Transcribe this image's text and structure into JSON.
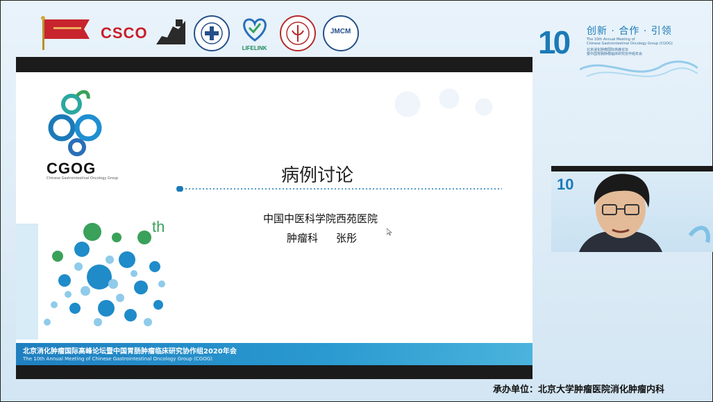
{
  "sponsors": {
    "csco": "CSCO",
    "lifelink": "LIFELINK",
    "jmcm": "JMCM",
    "icons": [
      "flag-logo",
      "csco-logo",
      "medical-seal-logo",
      "lifelink-logo",
      "hospital-seal-logo",
      "jmcm-seal-logo"
    ]
  },
  "brand": {
    "slogan": "创新 · 合作 · 引领",
    "ten": "10",
    "en_line1": "The 10th Annual Meeting of",
    "en_line2": "Chinese Gastrointestinal Oncology Group (CGOG)",
    "cn_line1": "北京消化肿瘤国际高峰论坛",
    "cn_line2": "暨中国胃肠肿瘤临床研究协作组年会"
  },
  "slide": {
    "logo_text": "CGOG",
    "logo_sub": "Chinese Gastrointestinal Oncology Group",
    "title": "病例讨论",
    "org": "中国中医科学院西苑医院",
    "dept": "肿瘤科",
    "presenter": "张彤",
    "th": "th",
    "band_cn": "北京消化肿瘤国际高峰论坛暨中国胃肠肿瘤临床研究协作组2020年会",
    "band_en": "The 10th Annual Meeting of Chinese Gastrointestinal Oncology Group (CGOG)"
  },
  "webcam": {
    "logo": "10"
  },
  "footer": {
    "host": "承办单位：北京大学肿瘤医院消化肿瘤内科"
  },
  "colors": {
    "accent": "#1c7ab8",
    "green": "#3aa15a",
    "band": "#1f7fc0"
  }
}
